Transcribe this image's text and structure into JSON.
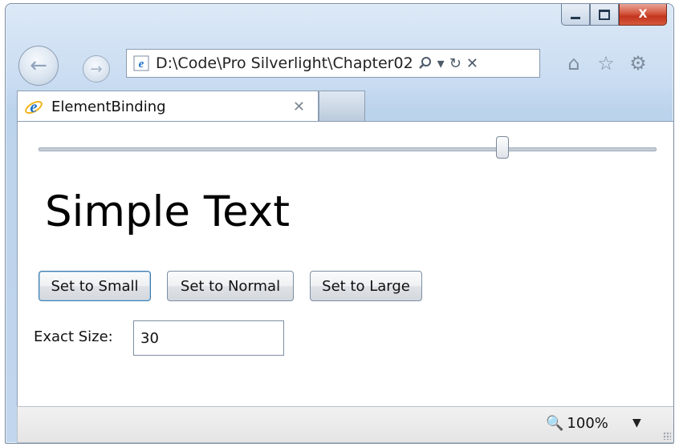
{
  "window": {
    "caption_buttons": {
      "minimize": "minimize",
      "maximize": "maximize",
      "close": "X"
    }
  },
  "nav": {
    "address": "D:\\Code\\Pro Silverlight\\Chapter02",
    "search_glyph": "⚲",
    "dropdown_glyph": "▾",
    "refresh_glyph": "↻",
    "stop_glyph": "✕",
    "right_icons": [
      "home-icon",
      "star-icon",
      "gear-icon"
    ]
  },
  "tab": {
    "title": "ElementBinding",
    "close_glyph": "✕"
  },
  "content": {
    "slider": {
      "value_fraction": 0.75
    },
    "sample_text": "Simple Text",
    "buttons": {
      "small": "Set to Small",
      "normal": "Set to Normal",
      "large": "Set to Large"
    },
    "exact_size_label": "Exact Size:",
    "exact_size_value": "30"
  },
  "status": {
    "zoom": "100%",
    "zoom_dropdown_glyph": "▼"
  }
}
